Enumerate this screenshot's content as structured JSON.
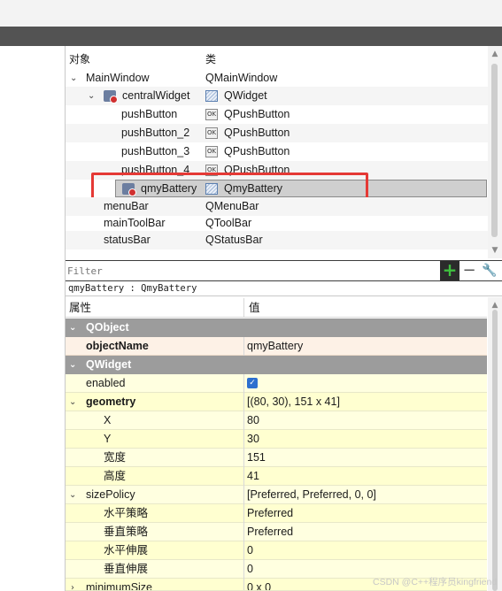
{
  "object_inspector": {
    "header": {
      "object": "对象",
      "class": "类"
    },
    "rows": [
      {
        "name": "MainWindow",
        "class": "QMainWindow"
      },
      {
        "name": "centralWidget",
        "class": "QWidget"
      },
      {
        "name": "pushButton",
        "class": "QPushButton"
      },
      {
        "name": "pushButton_2",
        "class": "QPushButton"
      },
      {
        "name": "pushButton_3",
        "class": "QPushButton"
      },
      {
        "name": "pushButton_4",
        "class": "QPushButton"
      },
      {
        "name": "qmyBattery",
        "class": "QmyBattery"
      },
      {
        "name": "menuBar",
        "class": "QMenuBar"
      },
      {
        "name": "mainToolBar",
        "class": "QToolBar"
      },
      {
        "name": "statusBar",
        "class": "QStatusBar"
      }
    ],
    "icon_button_text": "OK"
  },
  "filter": {
    "placeholder": "Filter"
  },
  "current_object_label": "qmyBattery : QmyBattery",
  "property_editor": {
    "header": {
      "property": "属性",
      "value": "值"
    },
    "rows": [
      {
        "name": "QObject",
        "value": ""
      },
      {
        "name": "objectName",
        "value": "qmyBattery"
      },
      {
        "name": "QWidget",
        "value": ""
      },
      {
        "name": "enabled",
        "value": ""
      },
      {
        "name": "geometry",
        "value": "[(80, 30), 151 x 41]"
      },
      {
        "name": "X",
        "value": "80"
      },
      {
        "name": "Y",
        "value": "30"
      },
      {
        "name": "宽度",
        "value": "151"
      },
      {
        "name": "高度",
        "value": "41"
      },
      {
        "name": "sizePolicy",
        "value": "[Preferred, Preferred, 0, 0]"
      },
      {
        "name": "水平策略",
        "value": "Preferred"
      },
      {
        "name": "垂直策略",
        "value": "Preferred"
      },
      {
        "name": "水平伸展",
        "value": "0"
      },
      {
        "name": "垂直伸展",
        "value": "0"
      },
      {
        "name": "minimumSize",
        "value": "0 x 0"
      }
    ],
    "enabled_checked": true
  },
  "watermark": "CSDN @C++程序员kingfriend",
  "colors": {
    "highlight_border": "#e53935",
    "group_header": "#9c9c9c",
    "checkbox": "#2d6fcf",
    "add_button": "#3fc03f"
  }
}
